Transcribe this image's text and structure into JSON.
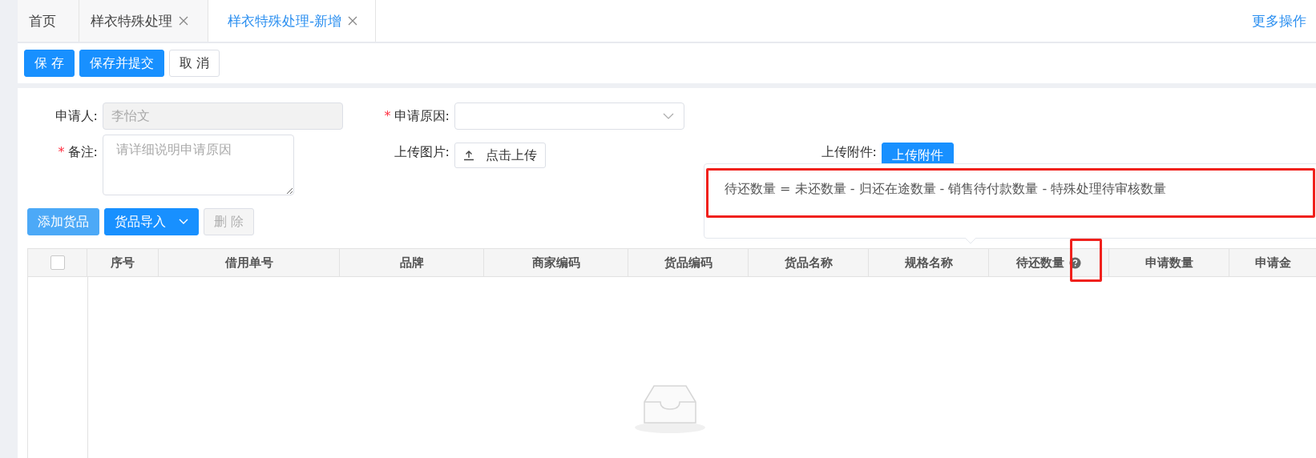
{
  "tabs": [
    {
      "label": "首页",
      "closable": false,
      "selected": false
    },
    {
      "label": "样衣特殊处理",
      "closable": true,
      "selected": false
    },
    {
      "label": "样衣特殊处理-新增",
      "closable": true,
      "selected": true
    }
  ],
  "more_actions": "更多操作",
  "toolbar": [
    {
      "label": "保 存",
      "kind": "primary"
    },
    {
      "label": "保存并提交",
      "kind": "primary"
    },
    {
      "label": "取 消",
      "kind": "default"
    }
  ],
  "form": {
    "applicant": {
      "label": "申请人:",
      "value": "李怡文",
      "disabled": true
    },
    "reason": {
      "label": "申请原因:",
      "required_mark": "*"
    },
    "remark": {
      "label": "备注:",
      "placeholder": "请详细说明申请原因",
      "required_mark": "*"
    },
    "upload_image": {
      "label": "上传图片:",
      "button": "点击上传"
    },
    "upload_attachment": {
      "label": "上传附件:",
      "button": "上传附件"
    }
  },
  "tooltip": {
    "text": "待还数量 = 未还数量 - 归还在途数量 - 销售待付款数量 - 特殊处理待审核数量"
  },
  "goods_buttons": [
    {
      "label": "添加货品",
      "kind": "light"
    },
    {
      "label": "货品导入",
      "kind": "dropdown"
    },
    {
      "label": "删 除",
      "kind": "disabled"
    }
  ],
  "table": {
    "select_all": {
      "checked": false
    },
    "columns": [
      {
        "label": "序号",
        "help": false
      },
      {
        "label": "借用单号",
        "help": false
      },
      {
        "label": "品牌",
        "help": false
      },
      {
        "label": "商家编码",
        "help": false
      },
      {
        "label": "货品编码",
        "help": false
      },
      {
        "label": "货品名称",
        "help": false
      },
      {
        "label": "规格名称",
        "help": false
      },
      {
        "label": "待还数量",
        "help": true
      },
      {
        "label": "申请数量",
        "help": false
      },
      {
        "label": "申请金",
        "help": false
      }
    ]
  }
}
